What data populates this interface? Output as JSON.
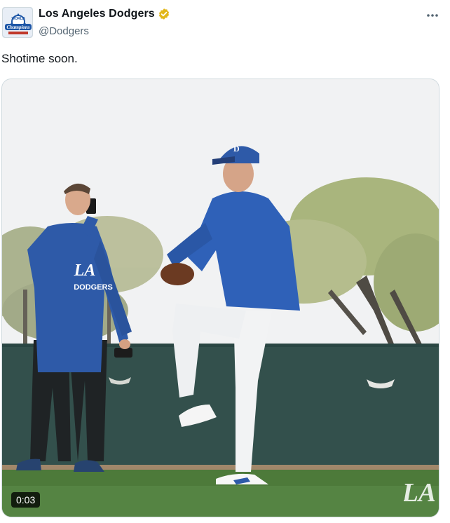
{
  "tweet": {
    "display_name": "Los Angeles Dodgers",
    "handle": "@Dodgers",
    "verified": true,
    "verified_icon": "gold-checkmark-badge-icon",
    "verified_color": "#e2b719",
    "more_icon": "ellipsis-icon",
    "text": "Shotime soon.",
    "avatar": {
      "icon": "world-champions-logo-avatar",
      "badge_text": "Champions",
      "top_text": "WORLD"
    }
  },
  "media": {
    "type": "video",
    "duration_label": "0:03",
    "watermark_icon": "la-logo-watermark",
    "watermark_text": "LA",
    "hoodie_chest_text": "LA",
    "hoodie_logo_text": "DODGERS"
  },
  "colors": {
    "text_primary": "#0f1419",
    "text_secondary": "#536471",
    "dodger_blue": "#2e5aa8"
  }
}
